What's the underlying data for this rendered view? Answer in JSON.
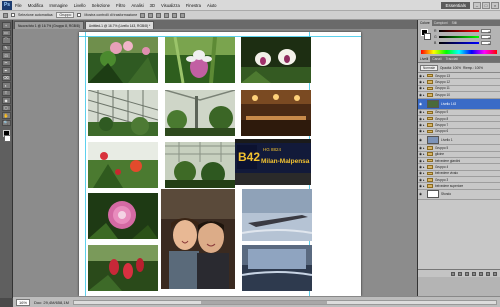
{
  "app": {
    "logo": "Ps",
    "workspace": "Essentials"
  },
  "menu": [
    "File",
    "Modifica",
    "Immagine",
    "Livello",
    "Selezione",
    "Filtro",
    "Analisi",
    "3D",
    "Visualizza",
    "Finestra",
    "Aiuto"
  ],
  "options": {
    "auto_select_label": "Selezione automatica:",
    "auto_select_value": "Gruppo",
    "transform_label": "Mostra controlli di trasformazione"
  },
  "tools": [
    "+",
    "▭",
    "⌒",
    "✎",
    "⊡",
    "✂",
    "✒",
    "⌫",
    "◐",
    "T",
    "◆",
    "▢",
    "✋",
    "🔍"
  ],
  "tabs": [
    {
      "label": "Nuova foto 1 @ 16.7% (Gruppo 8, RGB/8)"
    },
    {
      "label": "Untitled-1 @ 16.7% (Livello 143, RGB/8) *"
    }
  ],
  "status": {
    "zoom": "16%",
    "doc": "Doc: 29,4M/658,1M"
  },
  "colors_panel": {
    "tabs": [
      "Colore",
      "Campioni",
      "Stili"
    ],
    "r": "0",
    "g": "0",
    "b": "0"
  },
  "layers_panel": {
    "tabs": [
      "Livelli",
      "Canali",
      "Tracciati"
    ],
    "mode": "Normale",
    "opacity": "Opacità: 100%",
    "fill": "Riemp.: 100%",
    "rows": [
      {
        "name": "Gruppo 13",
        "kind": "folder"
      },
      {
        "name": "Gruppo 12",
        "kind": "folder"
      },
      {
        "name": "Gruppo 11",
        "kind": "folder"
      },
      {
        "name": "Gruppo 10",
        "kind": "folder"
      },
      {
        "name": "Livello 143",
        "kind": "selected"
      },
      {
        "name": "Gruppo 9",
        "kind": "folder"
      },
      {
        "name": "Gruppo 8",
        "kind": "folder"
      },
      {
        "name": "Gruppo 7",
        "kind": "folder"
      },
      {
        "name": "Gruppo 6",
        "kind": "folder"
      },
      {
        "name": "Livello 1",
        "kind": "thumb"
      },
      {
        "name": "Gruppo 5",
        "kind": "folder"
      },
      {
        "name": "glicine",
        "kind": "folder"
      },
      {
        "name": "belvedere giardini",
        "kind": "folder"
      },
      {
        "name": "Gruppo 4",
        "kind": "folder"
      },
      {
        "name": "belvedere vivaio",
        "kind": "folder"
      },
      {
        "name": "Gruppo 3",
        "kind": "folder"
      },
      {
        "name": "belvedere superiore",
        "kind": "folder"
      },
      {
        "name": "Sfondo",
        "kind": "background"
      }
    ]
  },
  "photo_texts": {
    "flight_code": "B42",
    "flight_num": "HG 8824",
    "destination": "Milan-Malpensa"
  },
  "accent_colors": {
    "selection": "#3a6bc7",
    "guides": "#33c6e8",
    "folder": "#d8b465"
  }
}
